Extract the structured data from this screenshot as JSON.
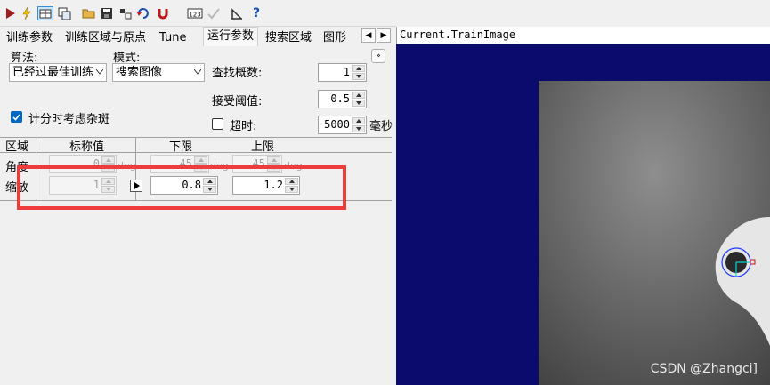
{
  "toolbar": {
    "icons": [
      "run-icon",
      "lightning-icon",
      "grid-view-icon",
      "copy-image-icon",
      "open-folder-icon",
      "save-icon",
      "region-icon",
      "undo-icon",
      "magnet-icon",
      "counter-icon",
      "checkmark-icon",
      "ruler-icon",
      "help-icon"
    ],
    "counter_text": "123",
    "help_text": "?"
  },
  "tabs": [
    "训练参数",
    "训练区域与原点",
    "Tune",
    "运行参数",
    "搜索区域",
    "图形"
  ],
  "active_tab": "运行参数",
  "params": {
    "algorithm_label": "算法:",
    "algorithm_value": "已经过最佳训练",
    "mode_label": "模式:",
    "mode_value": "搜索图像",
    "find_count_label": "查找概数:",
    "find_count_value": "1",
    "accept_threshold_label": "接受阈值:",
    "accept_threshold_value": "0.5",
    "timeout_label": "超时:",
    "timeout_value": "5000",
    "timeout_unit": "毫秒",
    "timeout_checked": false,
    "clutter_label": "计分时考虑杂斑",
    "clutter_checked": true
  },
  "table": {
    "headers": [
      "区域",
      "标称值",
      "下限",
      "上限"
    ],
    "rows": [
      {
        "label": "角度",
        "nominal": "0",
        "low": "-45",
        "high": "45",
        "enabled": false
      },
      {
        "label": "缩放",
        "nominal": "1",
        "low": "0.8",
        "high": "1.2",
        "enabled": true
      }
    ],
    "angle_unit": "deg"
  },
  "image": {
    "title": "Current.TrainImage",
    "watermark": "CSDN @Zhangci]"
  },
  "colors": {
    "canvas_bg": "#0b0b6e",
    "highlight": "#ee3b3b",
    "checkbox": "#0067c0"
  }
}
